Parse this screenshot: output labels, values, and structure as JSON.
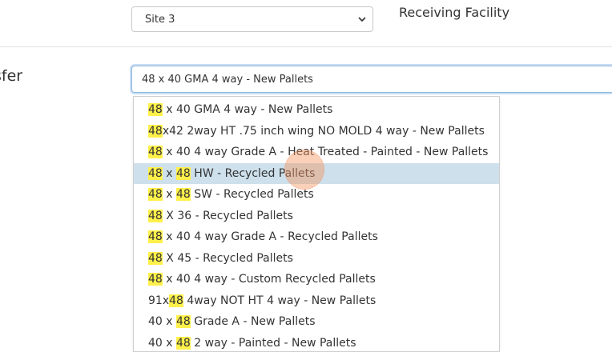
{
  "site_select": {
    "value": "Site 3"
  },
  "receiving_label": "Receiving Facility",
  "row_label": "sfer",
  "pallet_input": {
    "value": "48 x 40 GMA 4 way - New Pallets"
  },
  "dropdown": {
    "highlighted_index": 3,
    "options": [
      [
        {
          "t": "48",
          "h": true
        },
        {
          "t": " x 40 GMA 4 way - New Pallets",
          "h": false
        }
      ],
      [
        {
          "t": "48",
          "h": true
        },
        {
          "t": "x42 2way HT .75 inch wing NO MOLD 4 way - New Pallets",
          "h": false
        }
      ],
      [
        {
          "t": "48",
          "h": true
        },
        {
          "t": " x 40 4 way Grade A - Heat Treated - Painted - New Pallets",
          "h": false
        }
      ],
      [
        {
          "t": "48",
          "h": true
        },
        {
          "t": " x ",
          "h": false
        },
        {
          "t": "48",
          "h": true
        },
        {
          "t": " HW - Recycled Pallets",
          "h": false
        }
      ],
      [
        {
          "t": "48",
          "h": true
        },
        {
          "t": " x ",
          "h": false
        },
        {
          "t": "48",
          "h": true
        },
        {
          "t": " SW - Recycled Pallets",
          "h": false
        }
      ],
      [
        {
          "t": "48",
          "h": true
        },
        {
          "t": " X 36 - Recycled Pallets",
          "h": false
        }
      ],
      [
        {
          "t": "48",
          "h": true
        },
        {
          "t": " x 40 4 way Grade A - Recycled Pallets",
          "h": false
        }
      ],
      [
        {
          "t": "48",
          "h": true
        },
        {
          "t": " X 45 - Recycled Pallets",
          "h": false
        }
      ],
      [
        {
          "t": "48",
          "h": true
        },
        {
          "t": " x 40 4 way - Custom Recycled Pallets",
          "h": false
        }
      ],
      [
        {
          "t": "91x",
          "h": false
        },
        {
          "t": "48",
          "h": true
        },
        {
          "t": " 4way NOT HT 4 way - New Pallets",
          "h": false
        }
      ],
      [
        {
          "t": "40 x ",
          "h": false
        },
        {
          "t": "48",
          "h": true
        },
        {
          "t": " Grade A - New Pallets",
          "h": false
        }
      ],
      [
        {
          "t": "40 x ",
          "h": false
        },
        {
          "t": "48",
          "h": true
        },
        {
          "t": " 2 way - Painted - New Pallets",
          "h": false
        }
      ]
    ]
  },
  "colors": {
    "highlight_mark": "#fff04a",
    "option_hover": "#cde0ec",
    "focus_border": "#8fb8de"
  }
}
